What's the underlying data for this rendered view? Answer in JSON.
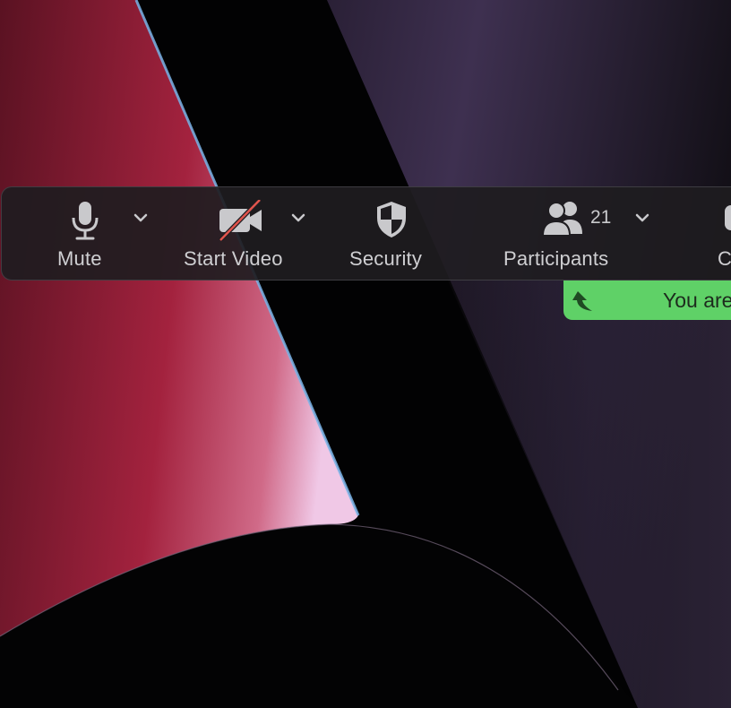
{
  "toolbar": {
    "mute": {
      "label": "Mute",
      "icon": "microphone-icon"
    },
    "video": {
      "label": "Start Video",
      "icon": "video-off-icon"
    },
    "security": {
      "label": "Security",
      "icon": "shield-icon"
    },
    "participants": {
      "label": "Participants",
      "count": "21",
      "icon": "participants-icon"
    },
    "next": {
      "label": "C"
    }
  },
  "notification": {
    "text": "You are",
    "icon": "arrow-up-icon",
    "color": "#5fd167"
  },
  "colors": {
    "toolbar_bg": "#1e1c20",
    "label": "#cfcfd2",
    "video_off_slash": "#e0544c"
  }
}
